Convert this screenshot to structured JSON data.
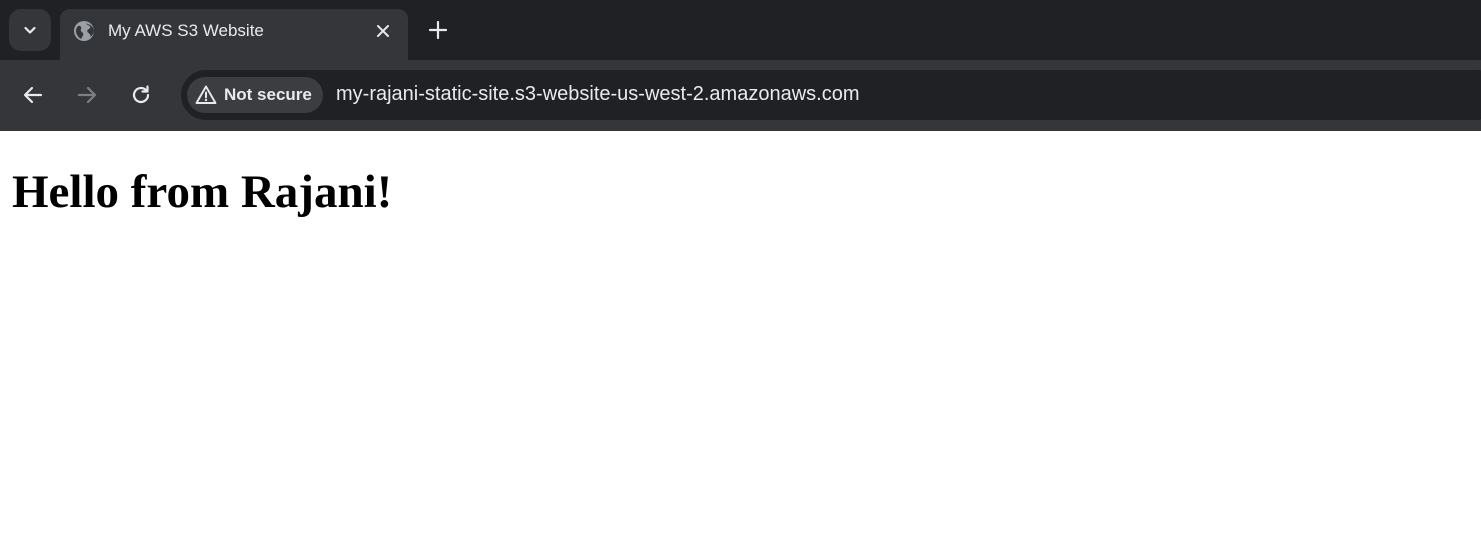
{
  "browser": {
    "tab": {
      "title": "My AWS S3 Website",
      "favicon": "globe-icon"
    },
    "toolbar": {
      "security_label": "Not secure",
      "url": "my-rajani-static-site.s3-website-us-west-2.amazonaws.com"
    },
    "colors": {
      "tabstrip_bg": "#202124",
      "toolbar_bg": "#35363a",
      "omnibox_bg": "#202124",
      "text": "#e8eaed"
    }
  },
  "page": {
    "heading": "Hello from Rajani!"
  }
}
